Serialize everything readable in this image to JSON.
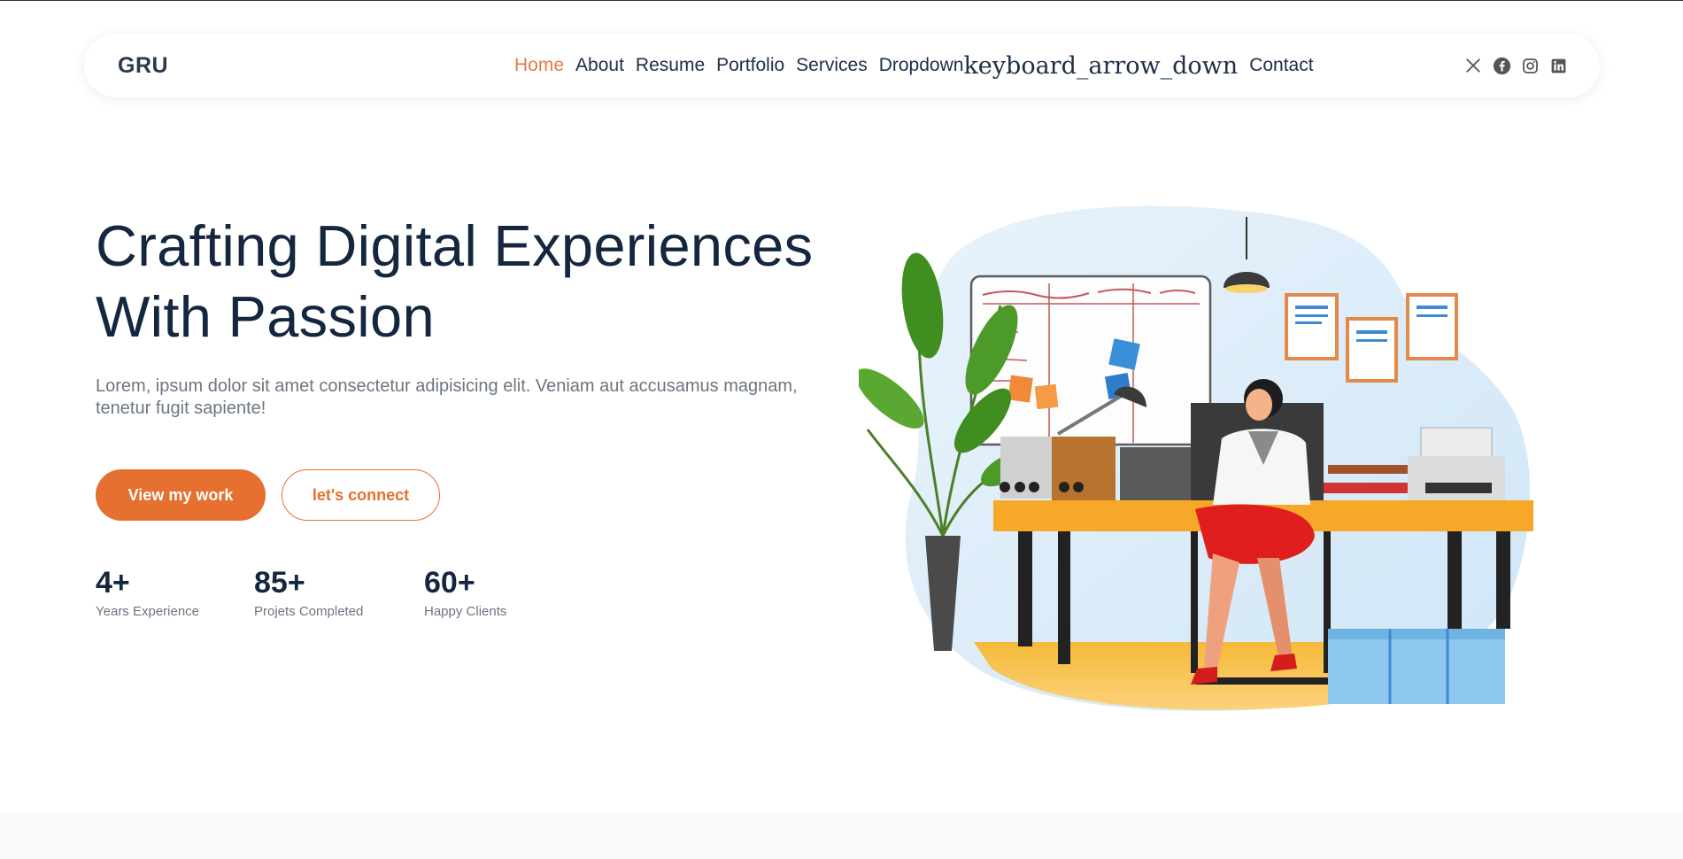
{
  "header": {
    "logo": "GRU",
    "nav": [
      {
        "label": "Home",
        "active": true
      },
      {
        "label": "About",
        "active": false
      },
      {
        "label": "Resume",
        "active": false
      },
      {
        "label": "Portfolio",
        "active": false
      },
      {
        "label": "Services",
        "active": false
      },
      {
        "label": "Dropdown",
        "active": false,
        "arrow_text": "keyboard_arrow_down"
      },
      {
        "label": "Contact",
        "active": false
      }
    ],
    "social_icons": [
      "x-icon",
      "facebook-icon",
      "instagram-icon",
      "linkedin-icon"
    ]
  },
  "hero": {
    "title_line1": "Crafting Digital Experiences",
    "title_line2": "With Passion",
    "subtitle": "Lorem, ipsum dolor sit amet consectetur adipisicing elit. Veniam aut accusamus magnam, tenetur fugit sapiente!",
    "primary_button": "View my work",
    "secondary_button": "let's connect",
    "stats": [
      {
        "value": "4+",
        "label": "Years Experience"
      },
      {
        "value": "85+",
        "label": "Projets Completed"
      },
      {
        "value": "60+",
        "label": "Happy Clients"
      }
    ]
  },
  "colors": {
    "accent": "#e5702f",
    "heading": "#14273f",
    "text_muted": "#6c7580"
  }
}
